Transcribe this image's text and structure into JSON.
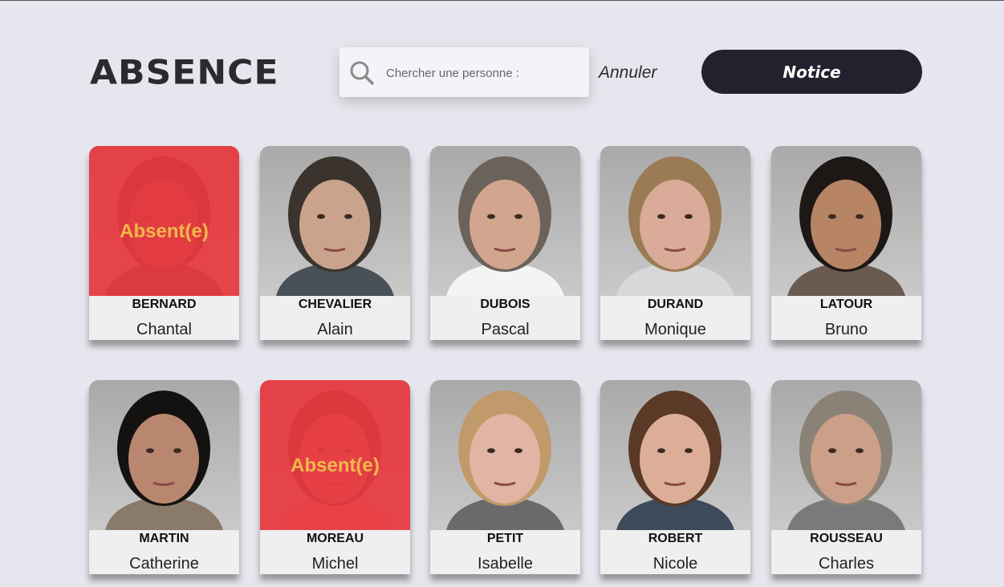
{
  "header": {
    "logo_text": "ABSENCE",
    "search": {
      "placeholder": "Chercher une personne :",
      "value": ""
    },
    "cancel_label": "Annuler",
    "notice_label": "Notice"
  },
  "cards": [
    {
      "lastname": "BERNARD",
      "firstname": "Chantal",
      "absent": true,
      "absent_label": "Absent(e)",
      "hair": "#2b1a14",
      "skin": "#8d5a44",
      "shirt": "#3a3a3a"
    },
    {
      "lastname": "CHEVALIER",
      "firstname": "Alain",
      "absent": false,
      "absent_label": "",
      "hair": "#3a332e",
      "skin": "#c9a38c",
      "shirt": "#4a5058"
    },
    {
      "lastname": "DUBOIS",
      "firstname": "Pascal",
      "absent": false,
      "absent_label": "",
      "hair": "#6b635b",
      "skin": "#d2a58f",
      "shirt": "#f4f4f4"
    },
    {
      "lastname": "DURAND",
      "firstname": "Monique",
      "absent": false,
      "absent_label": "",
      "hair": "#9a7b55",
      "skin": "#d9ab98",
      "shirt": "#d8d8d8"
    },
    {
      "lastname": "LATOUR",
      "firstname": "Bruno",
      "absent": false,
      "absent_label": "",
      "hair": "#1d1815",
      "skin": "#b88466",
      "shirt": "#6a5a50"
    },
    {
      "lastname": "MARTIN",
      "firstname": "Catherine",
      "absent": false,
      "absent_label": "",
      "hair": "#141210",
      "skin": "#b98770",
      "shirt": "#8a7a6a"
    },
    {
      "lastname": "MOREAU",
      "firstname": "Michel",
      "absent": true,
      "absent_label": "Absent(e)",
      "hair": "#3a2a24",
      "skin": "#c0907a",
      "shirt": "#e89aa0"
    },
    {
      "lastname": "PETIT",
      "firstname": "Isabelle",
      "absent": false,
      "absent_label": "",
      "hair": "#c09a6a",
      "skin": "#e0b5a3",
      "shirt": "#6a6a6a"
    },
    {
      "lastname": "ROBERT",
      "firstname": "Nicole",
      "absent": false,
      "absent_label": "",
      "hair": "#5a3a26",
      "skin": "#dcae98",
      "shirt": "#3c4a5a"
    },
    {
      "lastname": "ROUSSEAU",
      "firstname": "Charles",
      "absent": false,
      "absent_label": "",
      "hair": "#8a8276",
      "skin": "#cc9f88",
      "shirt": "#7a7a7a"
    }
  ]
}
